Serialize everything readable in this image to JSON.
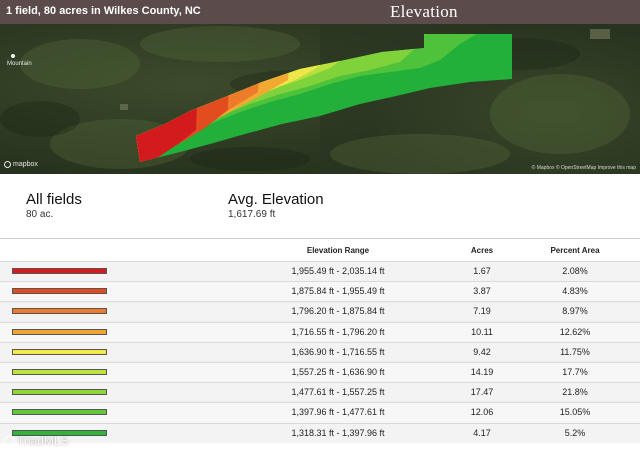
{
  "header": {
    "field_summary": "1 field, 80 acres in Wilkes County, NC",
    "report_title": "Elevation"
  },
  "map": {
    "place_label": "Mountain",
    "mapbox_label": "mapbox",
    "attribution": "© Mapbox © OpenStreetMap Improve this map"
  },
  "summary": {
    "fields_label": "All fields",
    "fields_value": "80 ac.",
    "avg_label": "Avg. Elevation",
    "avg_value": "1,617.69 ft"
  },
  "table": {
    "headers": {
      "range": "Elevation Range",
      "acres": "Acres",
      "percent": "Percent Area"
    },
    "rows": [
      {
        "color": "#d7191c",
        "range": "1,955.49 ft - 2,035.14 ft",
        "acres": "1.67",
        "percent": "2.08%"
      },
      {
        "color": "#e34a1e",
        "range": "1,875.84 ft - 1,955.49 ft",
        "acres": "3.87",
        "percent": "4.83%"
      },
      {
        "color": "#ee7b2c",
        "range": "1,796.20 ft - 1,875.84 ft",
        "acres": "7.19",
        "percent": "8.97%"
      },
      {
        "color": "#f0a432",
        "range": "1,716.55 ft - 1,796.20 ft",
        "acres": "10.11",
        "percent": "12.62%"
      },
      {
        "color": "#f5e84a",
        "range": "1,636.90 ft - 1,716.55 ft",
        "acres": "9.42",
        "percent": "11.75%"
      },
      {
        "color": "#bfe33e",
        "range": "1,557.25 ft - 1,636.90 ft",
        "acres": "14.19",
        "percent": "17.7%"
      },
      {
        "color": "#8fd63b",
        "range": "1,477.61 ft - 1,557.25 ft",
        "acres": "17.47",
        "percent": "21.8%"
      },
      {
        "color": "#5fc93a",
        "range": "1,397.96 ft - 1,477.61 ft",
        "acres": "12.06",
        "percent": "15.05%"
      },
      {
        "color": "#2fb53b",
        "range": "1,318.31 ft - 1,397.96 ft",
        "acres": "4.17",
        "percent": "5.2%"
      }
    ]
  },
  "watermark": "TriadMLS"
}
